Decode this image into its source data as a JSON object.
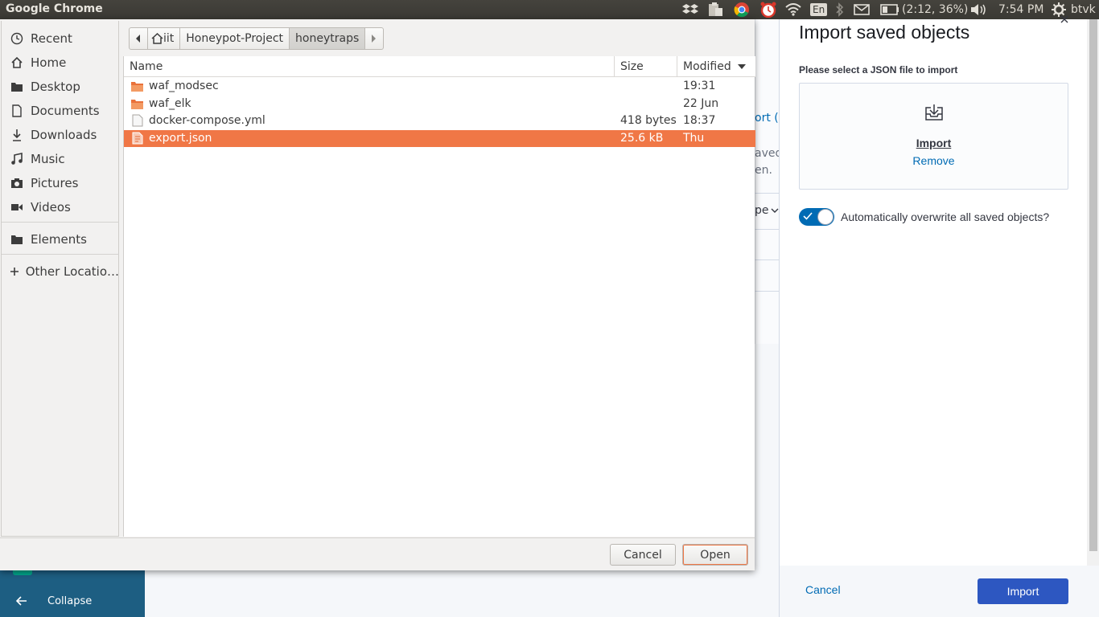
{
  "topbar": {
    "app_title": "Google Chrome",
    "battery": "(2:12, 36%)",
    "keyboard": "En",
    "clock": "7:54 PM",
    "user": "btvk",
    "icons": [
      "dropbox-icon",
      "clipboard-icon",
      "chrome-icon",
      "alarm-icon",
      "wifi-icon",
      "keyboard-layout-icon",
      "bluetooth-icon",
      "mail-icon",
      "battery-icon",
      "volume-icon",
      "settings-icon"
    ]
  },
  "file_dialog": {
    "places": [
      {
        "label": "Recent",
        "icon": "clock-icon"
      },
      {
        "label": "Home",
        "icon": "home-icon"
      },
      {
        "label": "Desktop",
        "icon": "folder-icon"
      },
      {
        "label": "Documents",
        "icon": "document-icon"
      },
      {
        "label": "Downloads",
        "icon": "download-icon"
      },
      {
        "label": "Music",
        "icon": "music-icon"
      },
      {
        "label": "Pictures",
        "icon": "camera-icon"
      },
      {
        "label": "Videos",
        "icon": "video-icon"
      },
      {
        "label": "Elements",
        "icon": "folder-icon"
      },
      {
        "label": "Other Locatio…",
        "icon": "plus-icon"
      }
    ],
    "pathbar": [
      "iit",
      "Honeypot-Project",
      "honeytraps"
    ],
    "columns": {
      "name": "Name",
      "size": "Size",
      "modified": "Modified"
    },
    "files": [
      {
        "name": "waf_modsec",
        "size": "",
        "modified": "19:31",
        "type": "folder",
        "selected": false
      },
      {
        "name": "waf_elk",
        "size": "",
        "modified": "22 Jun",
        "type": "folder",
        "selected": false
      },
      {
        "name": "docker-compose.yml",
        "size": "418 bytes",
        "modified": "18:37",
        "type": "file",
        "selected": false
      },
      {
        "name": "export.json",
        "size": "25.6 kB",
        "modified": "Thu",
        "type": "file",
        "selected": true
      }
    ],
    "cancel_label": "Cancel",
    "open_label": "Open"
  },
  "background": {
    "frag1": "ort (",
    "frag2": "aved",
    "frag3": "en.",
    "frag4": "pe",
    "collapse_label": "Collapse"
  },
  "flyout": {
    "title": "Import saved objects",
    "file_label": "Please select a JSON file to import",
    "dropzone_import": "Import",
    "dropzone_remove": "Remove",
    "overwrite_label": "Automatically overwrite all saved objects?",
    "overwrite_on": true,
    "cancel_label": "Cancel",
    "import_label": "Import"
  },
  "colors": {
    "accent_selection": "#f07746",
    "kibana_primary": "#006bb4",
    "import_button": "#2d57c1",
    "nav_background": "#1d5e82"
  }
}
